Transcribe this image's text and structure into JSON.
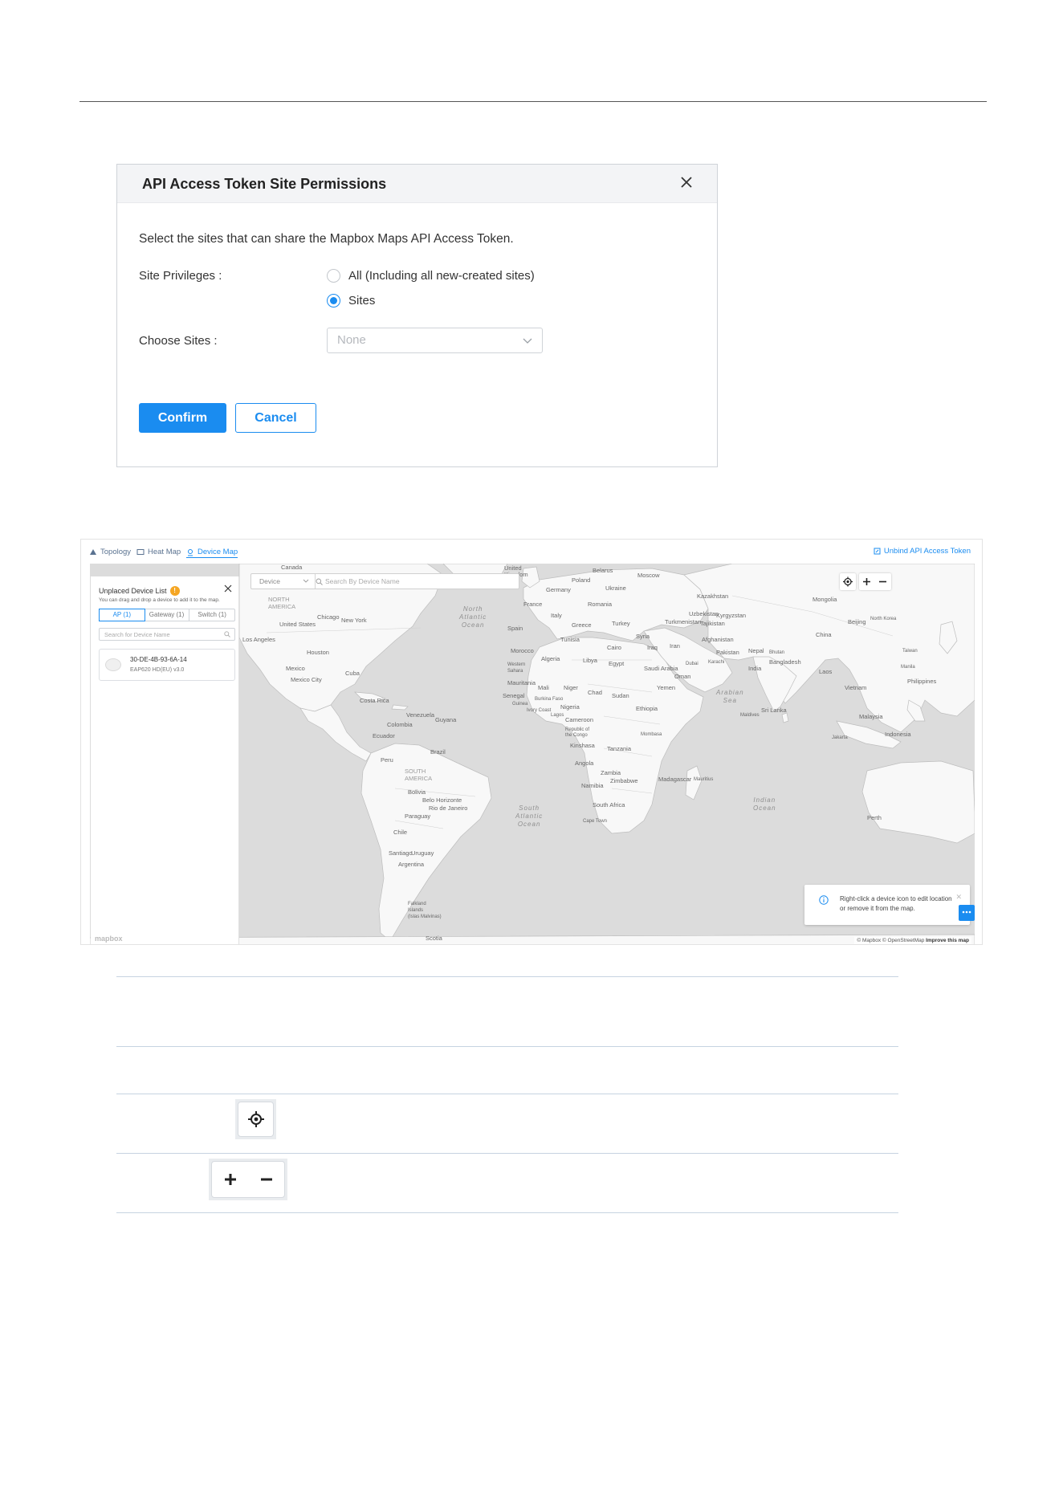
{
  "dialog": {
    "title": "API Access Token Site Permissions",
    "description": "Select the sites that can share the Mapbox Maps API Access Token.",
    "site_privileges_label": "Site Privileges",
    "option_all": "All (Including all new-created sites)",
    "option_sites": "Sites",
    "selected_option": "Sites",
    "choose_sites_label": "Choose Sites",
    "choose_sites_value": "None",
    "confirm_label": "Confirm",
    "cancel_label": "Cancel",
    "accent_color": "#1a8cf0"
  },
  "map_view": {
    "tabs": [
      {
        "label": "Topology",
        "icon": "topology-icon"
      },
      {
        "label": "Heat Map",
        "icon": "heat-map-icon"
      },
      {
        "label": "Device Map",
        "icon": "device-map-icon",
        "active": true
      }
    ],
    "unbind_label": "Unbind API Access Token",
    "panel": {
      "title": "Unplaced Device List",
      "badge": "!",
      "hint": "You can drag and drop a device to add it to the map.",
      "tabs": [
        "AP (1)",
        "Gateway (1)",
        "Switch (1)"
      ],
      "active_tab": "AP (1)",
      "search_placeholder": "Search for Device Name",
      "device": {
        "mac": "30-DE-4B-93-6A-14",
        "model": "EAP620 HD(EU) v3.0"
      }
    },
    "search": {
      "type": "Device",
      "placeholder": "Search By Device Name"
    },
    "tooltip": "Right-click a device icon to edit location or remove it from the map.",
    "attribution_prefix": "© Mapbox © OpenStreetMap",
    "attribution_link": "Improve this map",
    "logo": "mapbox",
    "labels": {
      "canada": "Canada",
      "north_america": "NORTH\nAMERICA",
      "united_states": "United States",
      "chicago": "Chicago",
      "new_york": "New York",
      "los_angeles": "Los Angeles",
      "houston": "Houston",
      "mexico": "Mexico",
      "mexico_city": "Mexico City",
      "cuba": "Cuba",
      "costa_rica": "Costa Rica",
      "colombia": "Colombia",
      "ecuador": "Ecuador",
      "peru": "Peru",
      "brazil": "Brazil",
      "south_america": "SOUTH\nAMERICA",
      "bolivia": "Bolivia",
      "paraguay": "Paraguay",
      "chile": "Chile",
      "argentina": "Argentina",
      "uruguay": "Uruguay",
      "santiago": "Santiago",
      "rio": "Rio de Janeiro",
      "belo": "Belo Horizonte",
      "falkland": "Falkland\nIslands\n(Islas Malvinas)",
      "scotia": "Scotia",
      "guyana": "Guyana",
      "venezuela": "Venezuela",
      "north_atlantic": "North\nAtlantic\nOcean",
      "south_atlantic": "South\nAtlantic\nOcean",
      "indian": "Indian\nOcean",
      "arabian": "Arabian\nSea",
      "uk": "United\nKingdom",
      "france": "France",
      "spain": "Spain",
      "italy": "Italy",
      "germany": "Germany",
      "poland": "Poland",
      "belarus": "Belarus",
      "ukraine": "Ukraine",
      "romania": "Romania",
      "moscow": "Moscow",
      "turkey": "Turkey",
      "greece": "Greece",
      "morocco": "Morocco",
      "algeria": "Algeria",
      "libya": "Libya",
      "egypt": "Egypt",
      "tunisia": "Tunisia",
      "cairo": "Cairo",
      "mali": "Mali",
      "niger": "Niger",
      "chad": "Chad",
      "sudan": "Sudan",
      "mauritania": "Mauritania",
      "western_sahara": "Western\nSahara",
      "senegal": "Senegal",
      "burkina": "Burkina Faso",
      "ivory": "Ivory Coast",
      "guinea": "Guinea",
      "nigeria": "Nigeria",
      "lagos": "Lagos",
      "cameroon": "Cameroon",
      "ethiopia": "Ethiopia",
      "yemen": "Yemen",
      "oman": "Oman",
      "saudi": "Saudi Arabia",
      "iraq": "Iraq",
      "syria": "Syria",
      "iran": "Iran",
      "congo": "Republic of\nthe Congo",
      "kinshasa": "Kinshasa",
      "tanzania": "Tanzania",
      "angola": "Angola",
      "zambia": "Zambia",
      "namibia": "Namibia",
      "zimbabwe": "Zimbabwe",
      "south_africa": "South Africa",
      "cape_town": "Cape Town",
      "madagascar": "Madagascar",
      "mauritius": "Mauritius",
      "kazakhstan": "Kazakhstan",
      "uzbekistan": "Uzbekistan",
      "kyrgyzstan": "Kyrgyzstan",
      "turkmenistan": "Turkmenistan",
      "tajikistan": "Tajikistan",
      "afghanistan": "Afghanistan",
      "pakistan": "Pakistan",
      "india": "India",
      "nepal": "Nepal",
      "bhutan": "Bhutan",
      "bangladesh": "Bangladesh",
      "karachi": "Karachi",
      "sri_lanka": "Sri Lanka",
      "maldives": "Maldives",
      "mongolia": "Mongolia",
      "china": "China",
      "beijing": "Beijing",
      "north_korea": "North Korea",
      "laos": "Laos",
      "vietnam": "Vietnam",
      "philippines": "Philippines",
      "malaysia": "Malaysia",
      "indonesia": "Indonesia",
      "jakarta": "Jakarta",
      "perth": "Perth",
      "tamoe": "Taiwan",
      "manila": "Manila",
      "dubai": "Dubai",
      "mombasa": "Mombasa"
    }
  }
}
